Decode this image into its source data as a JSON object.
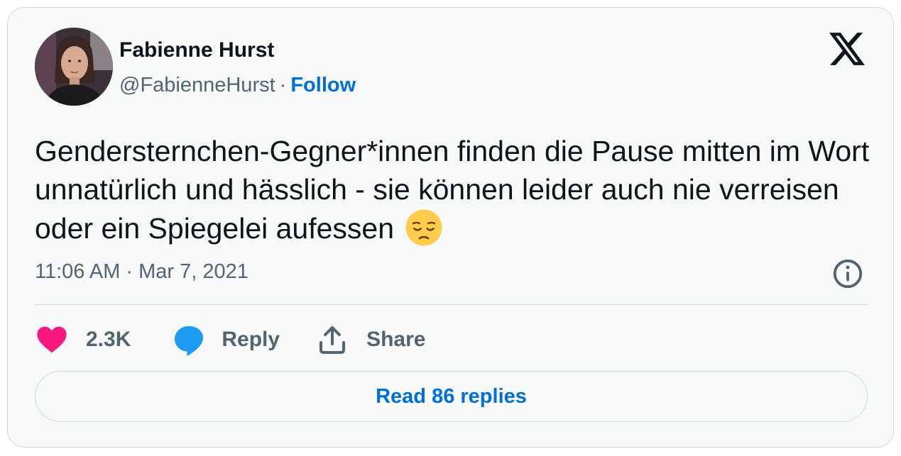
{
  "author": {
    "name": "Fabienne Hurst",
    "handle": "@FabienneHurst",
    "separator": "·",
    "follow_label": "Follow"
  },
  "tweet": {
    "text": "Gendersternchen-Gegner*innen finden die Pause mitten im Wort unnatürlich und hässlich - sie können leider auch nie verreisen oder ein Spiegelei aufessen",
    "emoji": "pensive-face",
    "timestamp": "11:06 AM · Mar 7, 2021"
  },
  "actions": {
    "like_count": "2.3K",
    "reply_label": "Reply",
    "share_label": "Share"
  },
  "read_replies_label": "Read 86 replies",
  "colors": {
    "like": "#f91880",
    "reply": "#1d9bf0",
    "link": "#006fd6",
    "muted": "#536471",
    "text": "#0f1419",
    "border": "#cfd9de"
  },
  "icons": [
    "x-logo-icon",
    "info-icon",
    "heart-icon",
    "speech-bubble-icon",
    "share-icon",
    "pensive-face-emoji"
  ]
}
